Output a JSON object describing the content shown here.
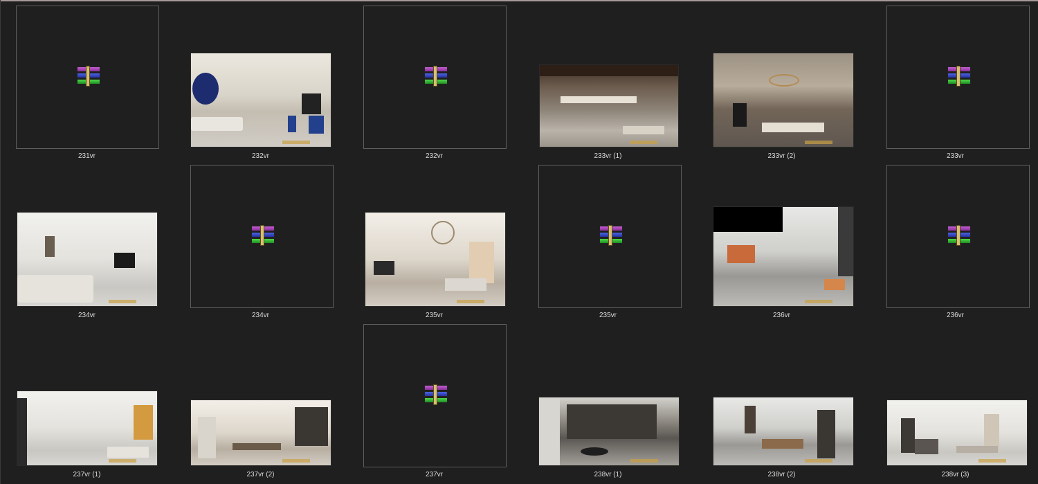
{
  "files": [
    {
      "name": "231vr",
      "kind": "archive",
      "icon": "archive-icon"
    },
    {
      "name": "232vr",
      "kind": "image",
      "style": "t-warm-light"
    },
    {
      "name": "232vr",
      "kind": "archive",
      "icon": "archive-icon"
    },
    {
      "name": "233vr (1)",
      "kind": "image",
      "style": "t-dark-marble"
    },
    {
      "name": "233vr (2)",
      "kind": "image",
      "style": "t-stone"
    },
    {
      "name": "233vr",
      "kind": "archive",
      "icon": "archive-icon"
    },
    {
      "name": "234vr",
      "kind": "image",
      "style": "t-white"
    },
    {
      "name": "234vr",
      "kind": "archive",
      "icon": "archive-icon"
    },
    {
      "name": "235vr",
      "kind": "image",
      "style": "t-soft"
    },
    {
      "name": "235vr",
      "kind": "archive",
      "icon": "archive-icon"
    },
    {
      "name": "236vr",
      "kind": "image",
      "style": "t-gray"
    },
    {
      "name": "236vr",
      "kind": "archive",
      "icon": "archive-icon"
    },
    {
      "name": "237vr (1)",
      "kind": "image",
      "style": "t-white"
    },
    {
      "name": "237vr (2)",
      "kind": "image",
      "style": "t-soft"
    },
    {
      "name": "237vr",
      "kind": "archive",
      "icon": "archive-icon"
    },
    {
      "name": "238vr (1)",
      "kind": "image",
      "style": "t-grey-dark"
    },
    {
      "name": "238vr (2)",
      "kind": "image",
      "style": "t-gray"
    },
    {
      "name": "238vr (3)",
      "kind": "image",
      "style": "t-white"
    }
  ],
  "colors": {
    "background": "#1f1f1f",
    "label_text": "#dcdcdc",
    "frame_border": "#5e5e5e"
  }
}
